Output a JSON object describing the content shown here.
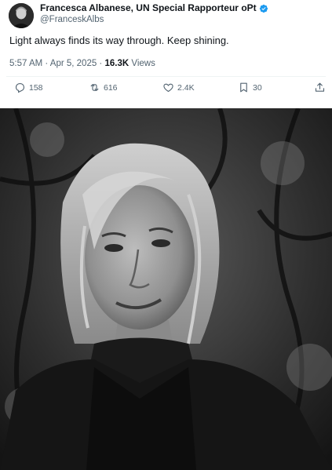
{
  "tweet": {
    "author": {
      "display_name": "Francesca Albanese, UN Special Rapporteur oPt",
      "handle": "@FranceskAlbs",
      "verified_icon": "verified-badge-icon",
      "accent_color": "#1d9bf0"
    },
    "text": "Light always finds its way through. Keep shining.",
    "meta": {
      "time_date": "5:57 AM · Apr 5, 2025 · ",
      "views_count": "16.3K",
      "views_label": " Views"
    },
    "actions": {
      "replies": "158",
      "retweets": "616",
      "likes": "2.4K",
      "bookmarks": "30"
    },
    "icons": {
      "reply": "reply-icon",
      "retweet": "retweet-icon",
      "like": "heart-icon",
      "bookmark": "bookmark-icon",
      "share": "share-icon"
    }
  }
}
